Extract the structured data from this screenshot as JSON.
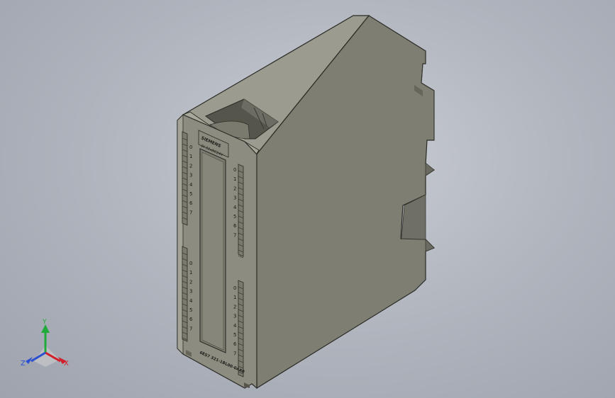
{
  "model": {
    "brand_label": "SIEMENS",
    "type_label": "DI 32xDC24V",
    "order_number": "6ES7 321-1BL00-0AA0",
    "channel_numbers": [
      "0",
      "1",
      "2",
      "3",
      "4",
      "5",
      "6",
      "7"
    ]
  },
  "triad": {
    "x_label": "X",
    "y_label": "Y",
    "z_label": "Z"
  },
  "colors": {
    "background": "#aeb3bc",
    "housing_side": "#7f7f74",
    "housing_front": "#8e8e82",
    "housing_top": "#9a9a8e",
    "edge": "#2b2b27",
    "axis_x": "#d21f2a",
    "axis_y": "#1faa3a",
    "axis_z": "#2a4fd0"
  }
}
